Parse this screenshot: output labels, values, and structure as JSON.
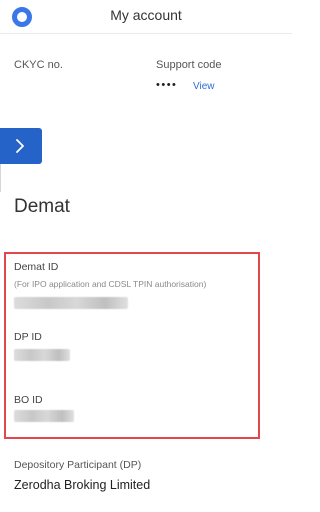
{
  "header": {
    "title": "My account",
    "logo_icon": "logo-ring-icon"
  },
  "account": {
    "ckyc_label": "CKYC no.",
    "support_label": "Support code",
    "support_masked": "••••",
    "view_label": "View"
  },
  "section": {
    "title": "Demat"
  },
  "demat": {
    "demat_id_label": "Demat ID",
    "demat_id_hint": "(For IPO application and CDSL TPIN authorisation)",
    "dp_id_label": "DP ID",
    "bo_id_label": "BO ID"
  },
  "dp": {
    "label": "Depository Participant (DP)",
    "value": "Zerodha Broking Limited"
  },
  "colors": {
    "accent": "#2563c9",
    "highlight_border": "#e3464b",
    "link": "#2f6fd6"
  }
}
